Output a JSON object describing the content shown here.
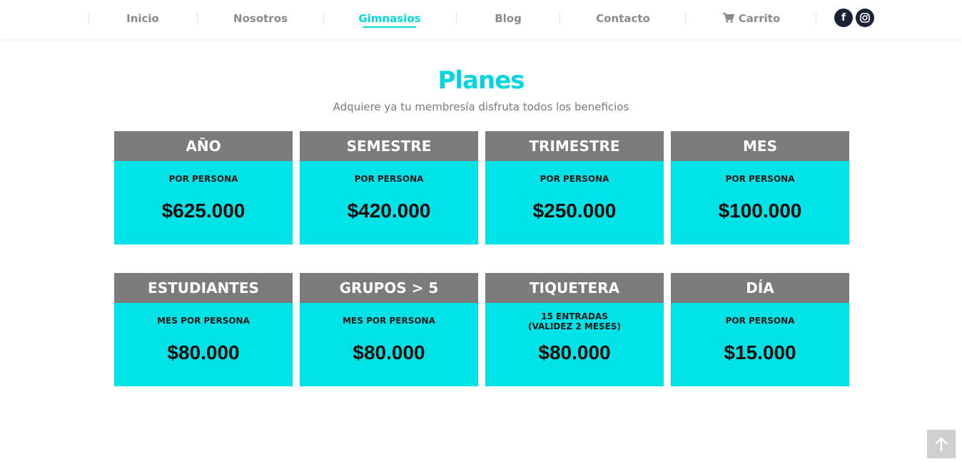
{
  "nav": {
    "items": [
      {
        "label": "Inicio"
      },
      {
        "label": "Nosotros"
      },
      {
        "label": "Gimnasios"
      },
      {
        "label": "Blog"
      },
      {
        "label": "Contacto"
      },
      {
        "label": "Carrito"
      }
    ],
    "active": "Gimnasios",
    "social": [
      "facebook-icon",
      "instagram-icon"
    ]
  },
  "header": {
    "title": "Planes",
    "subtitle": "Adquiere ya tu membresía disfruta todos los beneficios"
  },
  "plans": [
    {
      "name": "AÑO",
      "sub": "POR PERSONA",
      "price": "$625.000"
    },
    {
      "name": "SEMESTRE",
      "sub": "POR PERSONA",
      "price": "$420.000"
    },
    {
      "name": "TRIMESTRE",
      "sub": "POR PERSONA",
      "price": "$250.000"
    },
    {
      "name": "MES",
      "sub": "POR PERSONA",
      "price": "$100.000"
    },
    {
      "name": "ESTUDIANTES",
      "sub": "MES POR PERSONA",
      "price": "$80.000"
    },
    {
      "name": "GRUPOS > 5",
      "sub": "MES POR PERSONA",
      "price": "$80.000"
    },
    {
      "name": "TIQUETERA",
      "sub": "15 ENTRADAS",
      "sub2": "(VALIDEZ 2 MESES)",
      "price": "$80.000"
    },
    {
      "name": "DÍA",
      "sub": "POR PERSONA",
      "price": "$15.000"
    }
  ],
  "colors": {
    "accent": "#00d6df",
    "card_body": "#00e3e6",
    "card_header": "#7b7b7b",
    "nav_text": "#8a8a8a",
    "social_bg": "#1a2238"
  },
  "icons": {
    "cart": "cart-icon",
    "back_to_top": "arrow-up-icon"
  }
}
